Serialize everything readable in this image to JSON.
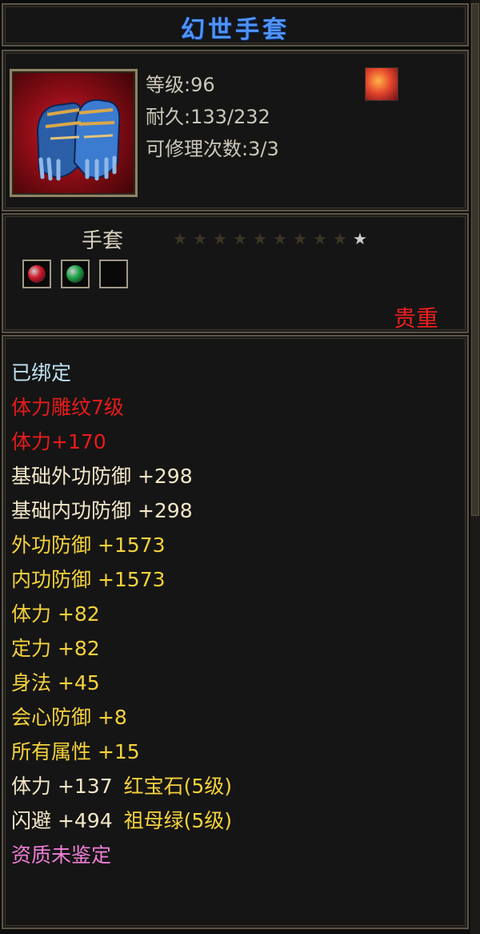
{
  "title": "幻世手套",
  "item": {
    "level": "等级:96",
    "durability": "耐久:133/232",
    "repairs": "可修理次数:3/3",
    "type": "手套",
    "rarity": "贵重",
    "star_count": 10,
    "stars_lit": 1,
    "gem_slots": [
      {
        "gem": "ruby",
        "color": "#d11a2a"
      },
      {
        "gem": "emerald",
        "color": "#1fa64a"
      },
      {
        "gem": "empty",
        "color": ""
      }
    ]
  },
  "attributes": [
    {
      "text": "已绑定",
      "color": "#bfe2f2"
    },
    {
      "text": "体力雕纹7级",
      "color": "#e81b1b"
    },
    {
      "text": "体力+170",
      "color": "#e81b1b"
    },
    {
      "text": "基础外功防御 +298",
      "color": "#f3e7c9"
    },
    {
      "text": "基础内功防御 +298",
      "color": "#f3e7c9"
    },
    {
      "text": "外功防御 +1573",
      "color": "#f5d23c"
    },
    {
      "text": "内功防御 +1573",
      "color": "#f5d23c"
    },
    {
      "text": "体力 +82",
      "color": "#f5d23c"
    },
    {
      "text": "定力 +82",
      "color": "#f5d23c"
    },
    {
      "text": "身法 +45",
      "color": "#f5d23c"
    },
    {
      "text": "会心防御 +8",
      "color": "#f5d23c"
    },
    {
      "text": "所有属性 +15",
      "color": "#f5d23c"
    },
    {
      "text": "体力 +137",
      "suffix": "红宝石(5级)",
      "color": "#f3e7c9",
      "suffix_color": "#f5d23c"
    },
    {
      "text": "闪避 +494",
      "suffix": "祖母绿(5级)",
      "color": "#f3e7c9",
      "suffix_color": "#f5d23c"
    },
    {
      "text": "资质未鉴定",
      "color": "#ef7ed6"
    }
  ]
}
